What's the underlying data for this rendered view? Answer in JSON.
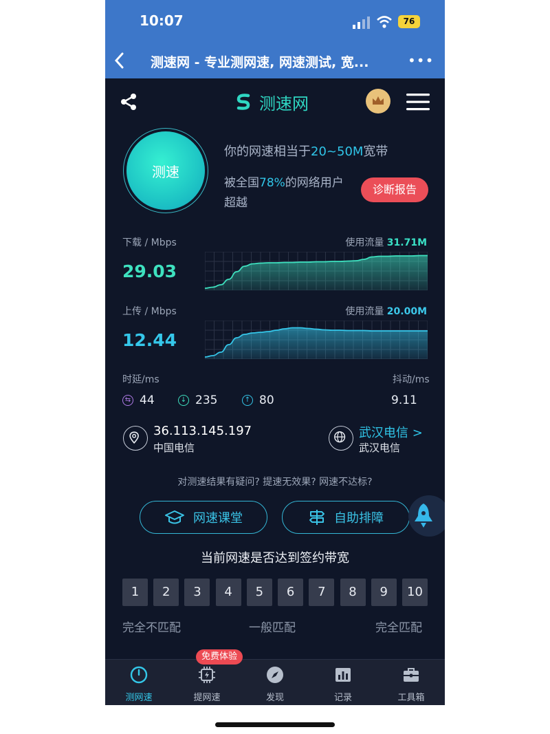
{
  "status_bar": {
    "time": "10:07",
    "battery": "76"
  },
  "browser": {
    "title": "测速网 - 专业测网速, 网速测试, 宽...",
    "more": "•••"
  },
  "app": {
    "logo_text": "测速网"
  },
  "test": {
    "button_label": "测速",
    "equiv_prefix": "你的网速相当于",
    "equiv_value": "20~50M",
    "equiv_suffix": "宽带",
    "exceed_prefix": "被全国",
    "exceed_percent": "78%",
    "exceed_suffix": "的网络用户",
    "exceed_tail": "超越",
    "report_button": "诊断报告"
  },
  "download": {
    "label": "下载 / Mbps",
    "value": "29.03",
    "usage_label": "使用流量",
    "usage_value": "31.71M",
    "curve": [
      0.02,
      0.05,
      0.12,
      0.28,
      0.5,
      0.66,
      0.73,
      0.75,
      0.76,
      0.76,
      0.77,
      0.77,
      0.78,
      0.78,
      0.79,
      0.79,
      0.8,
      0.8,
      0.81,
      0.82,
      0.86,
      0.93,
      0.95,
      0.95,
      0.96,
      0.96,
      0.96,
      0.97,
      0.97
    ]
  },
  "upload": {
    "label": "上传 / Mbps",
    "value": "12.44",
    "usage_label": "使用流量",
    "usage_value": "20.00M",
    "curve": [
      0.02,
      0.06,
      0.16,
      0.38,
      0.58,
      0.68,
      0.72,
      0.74,
      0.76,
      0.8,
      0.84,
      0.87,
      0.87,
      0.85,
      0.83,
      0.81,
      0.8,
      0.8,
      0.79,
      0.79,
      0.79,
      0.78,
      0.78,
      0.78,
      0.78,
      0.78,
      0.78,
      0.78,
      0.78
    ]
  },
  "latency": {
    "label": "时延/ms",
    "ping": "44",
    "down": "235",
    "up": "80",
    "jitter_label": "抖动/ms",
    "jitter": "9.11"
  },
  "network": {
    "ip": "36.113.145.197",
    "ip_isp": "中国电信",
    "server_link": "武汉电信 >",
    "server_isp": "武汉电信"
  },
  "help": {
    "question": "对测速结果有疑问? 提速无效果? 网速不达标?",
    "course_button": "网速课堂",
    "selfhelp_button": "自助排障"
  },
  "rating": {
    "title": "当前网速是否达到签约带宽",
    "scores": [
      "1",
      "2",
      "3",
      "4",
      "5",
      "6",
      "7",
      "8",
      "9",
      "10"
    ],
    "low": "完全不匹配",
    "mid": "一般匹配",
    "high": "完全匹配"
  },
  "tabs": [
    {
      "label": "测网速",
      "icon": "speedometer-icon",
      "active": true
    },
    {
      "label": "提网速",
      "icon": "chip-icon",
      "badge": "免费体验"
    },
    {
      "label": "发现",
      "icon": "compass-icon"
    },
    {
      "label": "记录",
      "icon": "bar-chart-icon"
    },
    {
      "label": "工具箱",
      "icon": "toolbox-icon"
    }
  ],
  "colors": {
    "accent": "#30c5e8",
    "download": "#3ee1bf",
    "upload": "#35c7ea",
    "danger": "#eb4e58",
    "header": "#3d77c9",
    "background": "#0f1628"
  }
}
